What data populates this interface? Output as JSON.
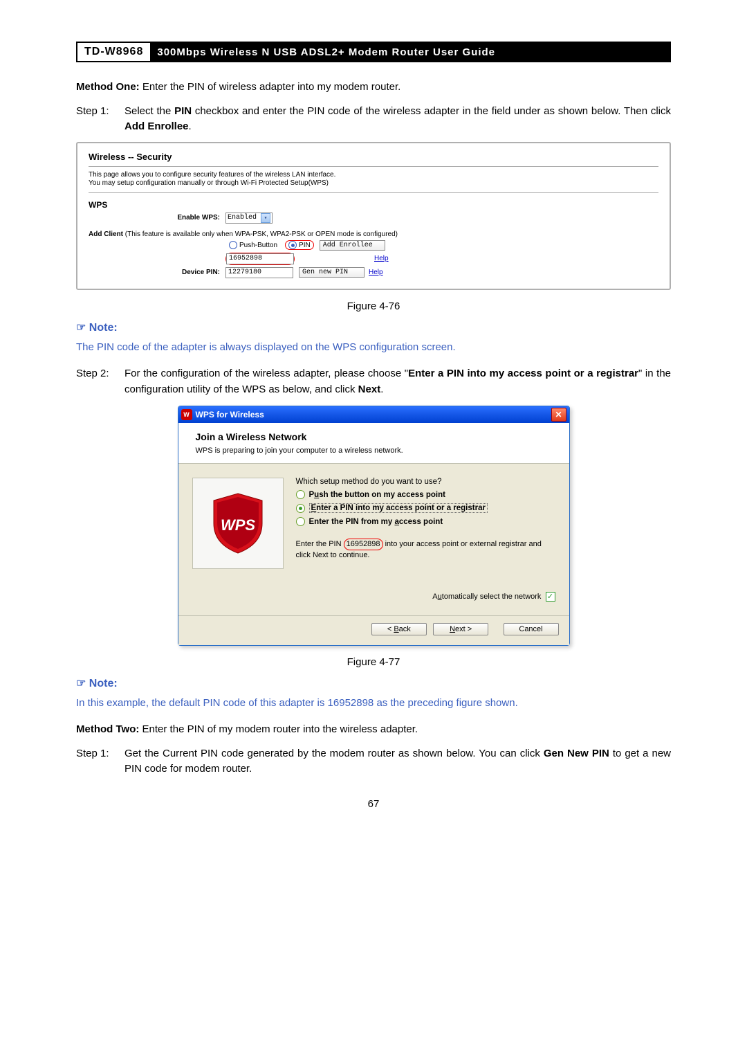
{
  "header": {
    "model": "TD-W8968",
    "title": "300Mbps Wireless N USB ADSL2+ Modem Router User Guide"
  },
  "method_one": {
    "strong": "Method One:",
    "text": " Enter the PIN of wireless adapter into my modem router."
  },
  "step1": {
    "label": "Step 1:",
    "pre": "Select the ",
    "bold1": "PIN",
    "mid": " checkbox and enter the PIN code of the wireless adapter in the field under as shown below. Then click ",
    "bold2": "Add Enrollee",
    "post": "."
  },
  "router": {
    "title": "Wireless -- Security",
    "desc1": "This page allows you to configure security features of the wireless LAN interface.",
    "desc2": "You may setup configuration manually or through Wi-Fi Protected Setup(WPS)",
    "wps": "WPS",
    "enable_wps_label": "Enable WPS:",
    "enable_wps_value": "Enabled",
    "add_client_pre": "Add Client",
    "add_client_note": " (This feature is available only when WPA-PSK, WPA2-PSK or OPEN mode is configured)",
    "push_button_label": "Push-Button",
    "pin_label": "PIN",
    "add_enrollee_btn": "Add Enrollee",
    "pin_value": "16952898",
    "help_link": "Help",
    "device_pin_label": "Device PIN:",
    "device_pin_value": "12279180",
    "gen_new_pin_btn": "Gen new PIN"
  },
  "fig1_caption": "Figure 4-76",
  "note1": {
    "label": "Note:",
    "text": "The PIN code of the adapter is always displayed on the WPS configuration screen."
  },
  "step2": {
    "label": "Step 2:",
    "t1": "For the configuration of the wireless adapter, please choose \"",
    "b1": "Enter a PIN into my access point or a registrar",
    "t2": "\" in the configuration utility of the WPS as below, and click ",
    "b2": "Next",
    "t3": "."
  },
  "wizard": {
    "window_title": "WPS for Wireless",
    "heading": "Join a Wireless Network",
    "subheading": "WPS is preparing to join your computer to a wireless network.",
    "question": "Which setup method do you want to use?",
    "opt1_pre": "P",
    "opt1_u": "u",
    "opt1_post": "sh the button on my access point",
    "opt2_u": "E",
    "opt2_post": "nter a PIN into my access point or a registrar",
    "opt3_pre": "Enter the PIN from my ",
    "opt3_u": "a",
    "opt3_post": "ccess point",
    "hint_pre": "Enter the PIN ",
    "hint_pin": "16952898",
    "hint_mid": " into your access point or external registrar and click Next to continue.",
    "auto_pre": "A",
    "auto_u": "u",
    "auto_post": "tomatically select the network",
    "back_pre": "< ",
    "back_u": "B",
    "back_post": "ack",
    "next_u": "N",
    "next_post": "ext >",
    "cancel": "Cancel",
    "shield_text": "WPS"
  },
  "fig2_caption": "Figure 4-77",
  "note2": {
    "label": "Note:",
    "text": "In this example, the default PIN code of this adapter is 16952898 as the preceding figure shown."
  },
  "method_two": {
    "strong": "Method Two:",
    "text": " Enter the PIN of my modem router into the wireless adapter."
  },
  "step1b": {
    "label": "Step 1:",
    "t1": "Get the Current PIN code generated by the modem router as shown below. You can click ",
    "b1": "Gen New PIN",
    "t2": " to get a new PIN code for modem router."
  },
  "page_num": "67"
}
